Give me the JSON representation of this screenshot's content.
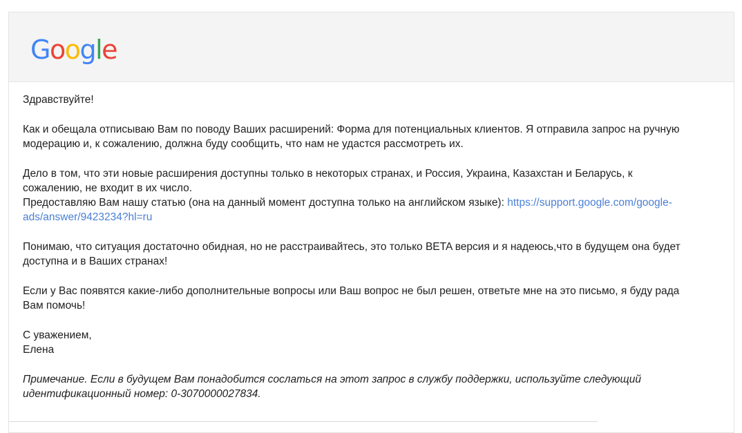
{
  "logo": {
    "text": "Google",
    "letters": [
      {
        "char": "G",
        "color": "#4285F4"
      },
      {
        "char": "o",
        "color": "#EA4335"
      },
      {
        "char": "o",
        "color": "#FBBC05"
      },
      {
        "char": "g",
        "color": "#4285F4"
      },
      {
        "char": "l",
        "color": "#34A853"
      },
      {
        "char": "e",
        "color": "#EA4335"
      }
    ]
  },
  "email": {
    "greeting": "Здравствуйте!",
    "paragraph1": "Как и обещала отписываю Вам по поводу Ваших расширений: Форма для потенциальных клиентов. Я отправила запрос на ручную модерацию и, к сожалению, должна буду сообщить, что нам не удастся рассмотреть их.",
    "paragraph2_line1": "Дело в том, что эти новые расширения доступны только в некоторых странах, и Россия, Украина, Казахстан и Беларусь, к сожалению, не входит в их число.",
    "paragraph2_line2_prefix": "Предоставляю Вам нашу статью (она на данный момент доступна только на английском языке): ",
    "article_link": "https://support.google.com/google-ads/answer/9423234?hl=ru",
    "paragraph3": "Понимаю, что ситуация достаточно обидная, но не расстраивайтесь, это только BETA версия и я надеюсь,что в будущем она будет доступна и в Ваших странах!",
    "paragraph4": "Если у Вас появятся какие-либо дополнительные вопросы или Ваш вопрос не был решен, ответьте мне на это письмо, я буду рада Вам помочь!",
    "closing": "С уважением,",
    "signature": "Елена",
    "note": "Примечание. Если в будущем Вам понадобится сослаться на этот запрос в службу поддержки, используйте следующий идентификационный номер: 0-3070000027834."
  }
}
